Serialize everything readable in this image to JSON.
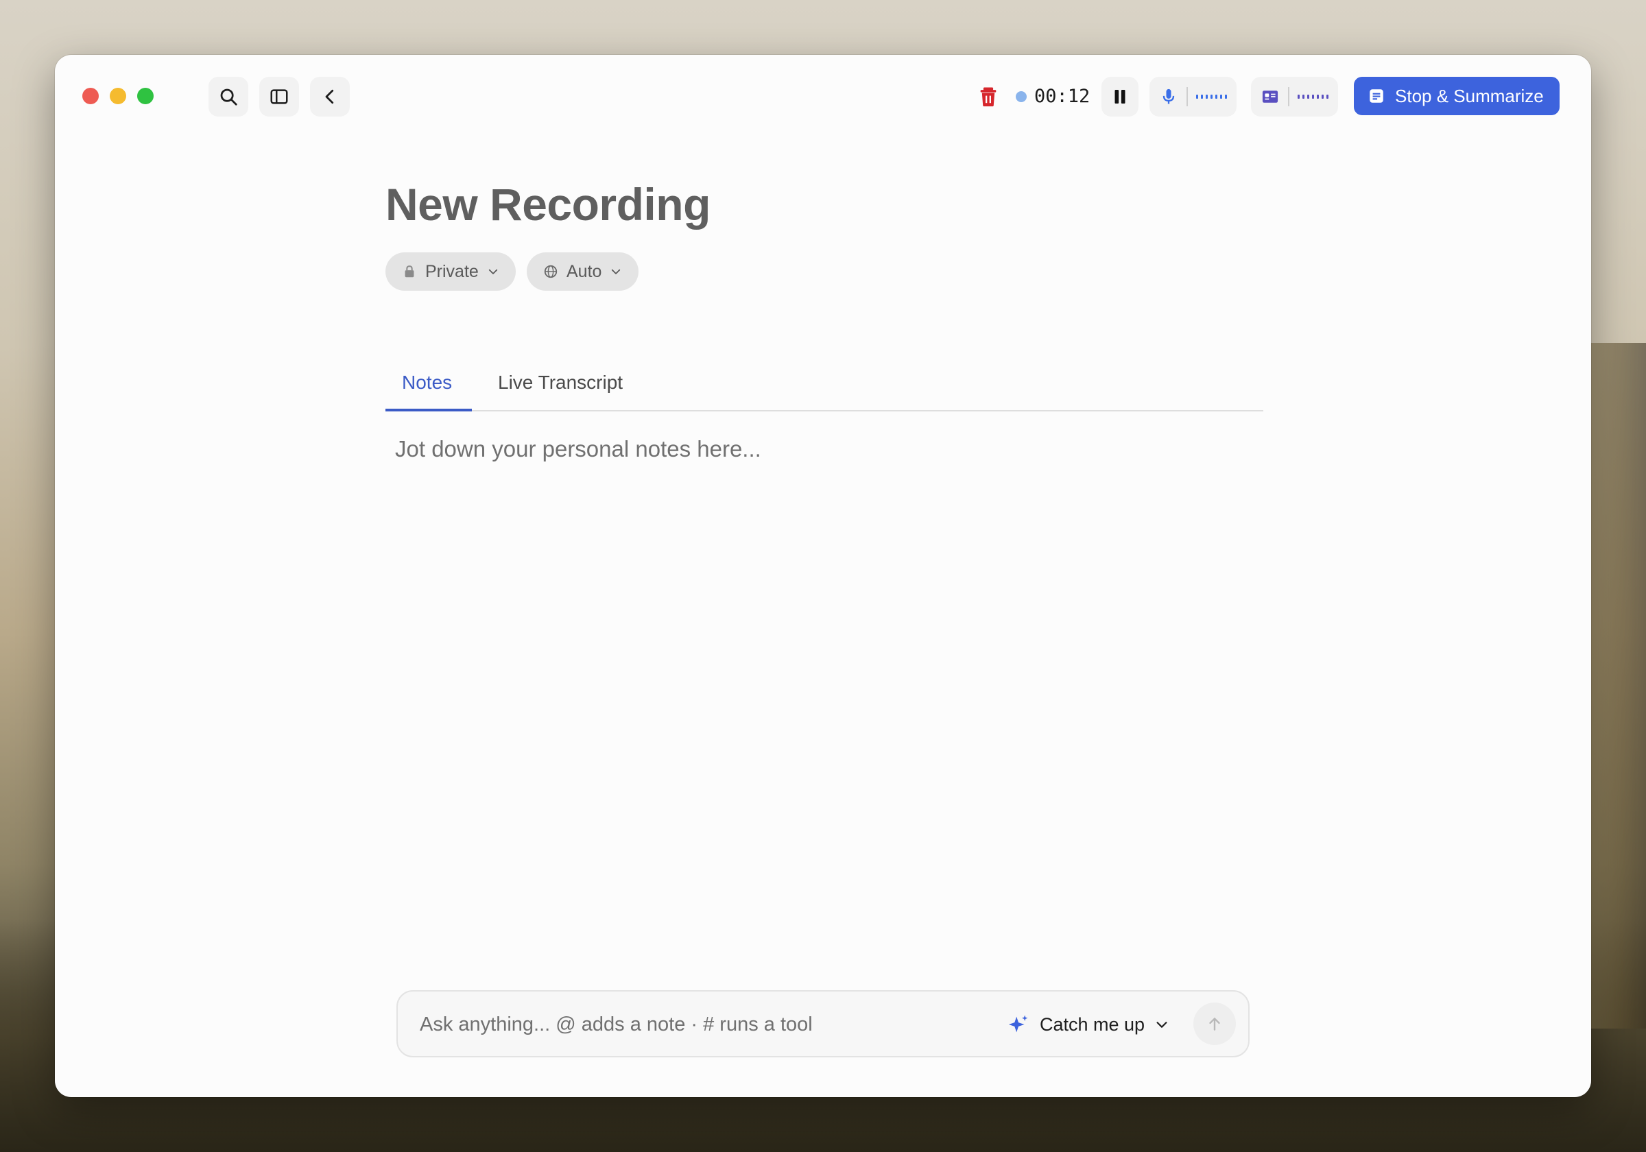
{
  "window": {
    "traffic_lights": [
      "close",
      "minimize",
      "zoom"
    ]
  },
  "toolbar": {
    "search_icon": "search-icon",
    "sidebar_icon": "sidebar-toggle-icon",
    "back_icon": "chevron-left-icon",
    "trash_icon": "trash-icon",
    "recording_indicator_color": "#8ab4ec",
    "timer": "00:12",
    "pause_icon": "pause-icon",
    "mic_icon": "microphone-icon",
    "system_audio_icon": "system-audio-icon",
    "stop_label": "Stop & Summarize",
    "accent_color": "#3d63dd"
  },
  "note": {
    "title": "New Recording",
    "privacy_label": "Private",
    "language_label": "Auto"
  },
  "tabs": [
    {
      "label": "Notes",
      "active": true
    },
    {
      "label": "Live Transcript",
      "active": false
    }
  ],
  "editor": {
    "placeholder": "Jot down your personal notes here..."
  },
  "ask": {
    "placeholder": "Ask anything... @ adds a note · # runs a tool",
    "mode_label": "Catch me up"
  }
}
